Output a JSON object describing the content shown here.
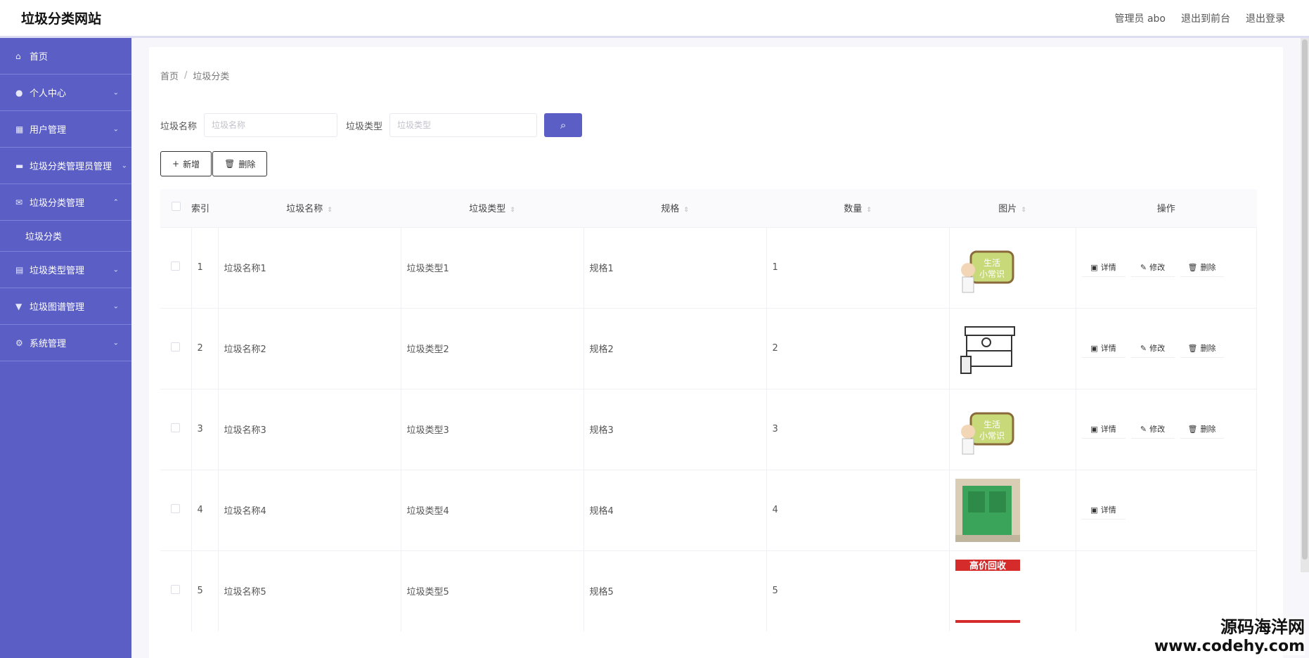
{
  "header": {
    "title": "垃圾分类网站",
    "admin_label": "管理员 abo",
    "back_front": "退出到前台",
    "logout": "退出登录"
  },
  "sidebar": {
    "items": [
      {
        "label": "首页",
        "icon": "home-icon"
      },
      {
        "label": "个人中心",
        "icon": "user-icon"
      },
      {
        "label": "用户管理",
        "icon": "grid-icon"
      },
      {
        "label": "垃圾分类管理员管理",
        "icon": "admin-icon"
      },
      {
        "label": "垃圾分类管理",
        "icon": "mail-icon"
      },
      {
        "label": "垃圾分类",
        "icon": ""
      },
      {
        "label": "垃圾类型管理",
        "icon": "clipboard-icon"
      },
      {
        "label": "垃圾图谱管理",
        "icon": "filter-icon"
      },
      {
        "label": "系统管理",
        "icon": "gear-icon"
      }
    ]
  },
  "breadcrumb": {
    "home": "首页",
    "sep": "/",
    "current": "垃圾分类"
  },
  "search": {
    "name_label": "垃圾名称",
    "name_placeholder": "垃圾名称",
    "type_label": "垃圾类型",
    "type_placeholder": "垃圾类型"
  },
  "actions": {
    "add": "新增",
    "delete": "删除"
  },
  "table": {
    "headers": {
      "index": "索引",
      "name": "垃圾名称",
      "type": "垃圾类型",
      "spec": "规格",
      "qty": "数量",
      "image": "图片",
      "ops": "操作"
    },
    "rows": [
      {
        "index": "1",
        "name": "垃圾名称1",
        "type": "垃圾类型1",
        "spec": "规格1",
        "qty": "1",
        "image": "cartoon-badge"
      },
      {
        "index": "2",
        "name": "垃圾名称2",
        "type": "垃圾类型2",
        "spec": "规格2",
        "qty": "2",
        "image": "sketch-kiosk"
      },
      {
        "index": "3",
        "name": "垃圾名称3",
        "type": "垃圾类型3",
        "spec": "规格3",
        "qty": "3",
        "image": "cartoon-badge"
      },
      {
        "index": "4",
        "name": "垃圾名称4",
        "type": "垃圾类型4",
        "spec": "规格4",
        "qty": "4",
        "image": "green-bin"
      },
      {
        "index": "5",
        "name": "垃圾名称5",
        "type": "垃圾类型5",
        "spec": "规格5",
        "qty": "5",
        "image": "recycle-banner"
      }
    ],
    "op_labels": {
      "detail": "详情",
      "edit": "修改",
      "delete": "删除"
    }
  },
  "images": {
    "badge_text1": "生活",
    "badge_text2": "小常识",
    "banner_text": "高价回收"
  },
  "watermark": {
    "line1": "源码海洋网",
    "line2": "www.codehy.com"
  },
  "colors": {
    "accent": "#5b5fc5"
  }
}
